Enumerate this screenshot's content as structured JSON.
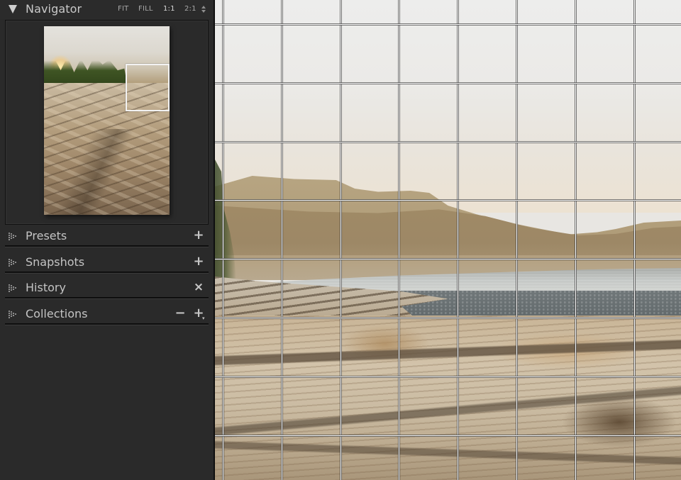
{
  "navigator": {
    "title": "Navigator",
    "collapse_icon": "triangle-down-icon",
    "zoom_options": [
      "FIT",
      "FILL",
      "1:1",
      "2:1"
    ],
    "zoom_more_icon": "updown-arrows-icon",
    "preview_description": "Driftwood-covered beach with evergreen trees and sun flare",
    "viewport_rectangle_visible": true
  },
  "sections": [
    {
      "title": "Presets",
      "icon": "triangle-right-icon",
      "actions": [
        {
          "icon": "plus-icon",
          "label": "+"
        }
      ]
    },
    {
      "title": "Snapshots",
      "icon": "triangle-right-icon",
      "actions": [
        {
          "icon": "plus-icon",
          "label": "+"
        }
      ]
    },
    {
      "title": "History",
      "icon": "triangle-right-icon",
      "actions": [
        {
          "icon": "close-icon",
          "label": "×"
        }
      ]
    },
    {
      "title": "Collections",
      "icon": "triangle-right-icon",
      "actions": [
        {
          "icon": "minus-icon",
          "label": "−"
        },
        {
          "icon": "plus-dropdown-icon",
          "label": "+",
          "sub": "▾"
        }
      ]
    }
  ],
  "photo": {
    "description": "Zoomed 1:1 view of driftwood beach with misty mountains and water",
    "grid_overlay": true
  },
  "colors": {
    "panel_bg": "#2a2a2a",
    "text": "#c4c4c4",
    "grid": "#ffffff"
  }
}
